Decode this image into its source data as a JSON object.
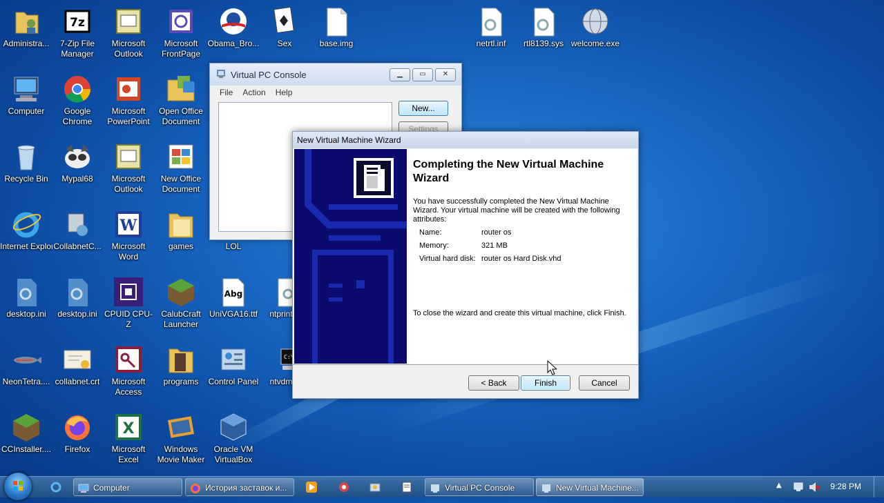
{
  "desktop": {
    "icons": [
      {
        "label": "Administra..."
      },
      {
        "label": "7-Zip File Manager"
      },
      {
        "label": "Microsoft Outlook"
      },
      {
        "label": "Microsoft FrontPage"
      },
      {
        "label": "Obama_Bro..."
      },
      {
        "label": "Sex"
      },
      {
        "label": "base.img"
      },
      {
        "label": "netrtl.inf"
      },
      {
        "label": "rtl8139.sys"
      },
      {
        "label": "welcome.exe"
      },
      {
        "label": "Computer"
      },
      {
        "label": "Google Chrome"
      },
      {
        "label": "Microsoft PowerPoint"
      },
      {
        "label": "Open Office Document"
      },
      {
        "label": "Recycle Bin"
      },
      {
        "label": "Mypal68"
      },
      {
        "label": "Microsoft Outlook"
      },
      {
        "label": "New Office Document"
      },
      {
        "label": "Internet Explorer"
      },
      {
        "label": "CollabnetC..."
      },
      {
        "label": "Microsoft Word"
      },
      {
        "label": "games"
      },
      {
        "label": "LOL"
      },
      {
        "label": "desktop.ini"
      },
      {
        "label": "desktop.ini"
      },
      {
        "label": "CPUID CPU-Z"
      },
      {
        "label": "CalubCraft Launcher"
      },
      {
        "label": "UniVGA16.ttf"
      },
      {
        "label": "ntprint..."
      },
      {
        "label": "NeonTetra...."
      },
      {
        "label": "collabnet.crt"
      },
      {
        "label": "Microsoft Access"
      },
      {
        "label": "programs"
      },
      {
        "label": "Control Panel"
      },
      {
        "label": "ntvdm..."
      },
      {
        "label": "CCInstaller...."
      },
      {
        "label": "Firefox"
      },
      {
        "label": "Microsoft Excel"
      },
      {
        "label": "Windows Movie Maker"
      },
      {
        "label": "Oracle VM VirtualBox"
      }
    ],
    "font_preview_text": "Abg"
  },
  "vpc_console": {
    "title": "Virtual PC Console",
    "menu": [
      "File",
      "Action",
      "Help"
    ],
    "new_button": "New...",
    "settings_button": "Settings"
  },
  "wizard": {
    "title": "New Virtual Machine Wizard",
    "heading": "Completing the New Virtual Machine Wizard",
    "intro": "You have successfully completed the New Virtual Machine Wizard. Your virtual machine will be created with the following attributes:",
    "attributes": [
      {
        "label": "Name:",
        "value": "router os"
      },
      {
        "label": "Memory:",
        "value": "321 MB"
      },
      {
        "label": "Virtual hard disk:",
        "value": "router os Hard Disk.vhd"
      }
    ],
    "closing": "To close the wizard and create this virtual machine, click Finish.",
    "back_button": "< Back",
    "finish_button": "Finish",
    "cancel_button": "Cancel"
  },
  "taskbar": {
    "buttons": [
      {
        "label": "Computer"
      },
      {
        "label": "История заставок и..."
      },
      {
        "label": "Virtual PC Console"
      },
      {
        "label": "New Virtual Machine..."
      }
    ],
    "clock": "9:28 PM"
  },
  "colors": {
    "wizard_side": "#0b0b6e",
    "taskbar": "#1f4f86",
    "desktop": "#1968c4"
  }
}
